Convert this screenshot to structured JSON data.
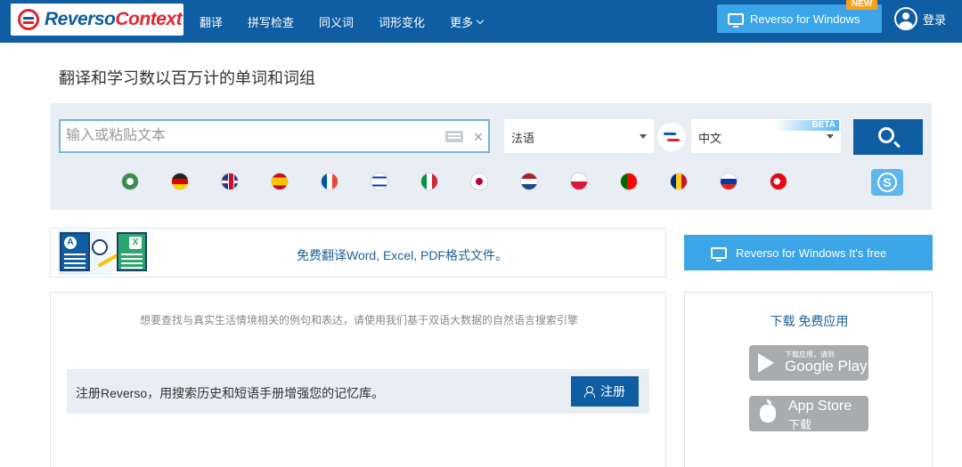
{
  "header": {
    "logo_reverso": "Reverso",
    "logo_context": "Context",
    "nav": [
      {
        "label": "翻译"
      },
      {
        "label": "拼写检查"
      },
      {
        "label": "同义词"
      },
      {
        "label": "词形变化"
      },
      {
        "label": "更多"
      }
    ],
    "windows_button": "Reverso for Windows",
    "new_badge": "NEW",
    "login": "登录"
  },
  "tagline": "翻译和学习数以百万计的单词和词组",
  "search": {
    "placeholder": "输入或粘贴文本",
    "value": "",
    "clear_icon": "×",
    "source_language": "法语",
    "target_language": "中文",
    "beta_badge": "BETA"
  },
  "flags": [
    "arabic",
    "german",
    "english",
    "spanish",
    "french",
    "hebrew",
    "italian",
    "japanese",
    "dutch",
    "polish",
    "portuguese",
    "romanian",
    "russian",
    "turkish"
  ],
  "skype_letter": "S",
  "doc_banner": {
    "text": "免费翻译Word, Excel, PDF格式文件。",
    "icon_a": "A",
    "icon_x": "X"
  },
  "free_button": "Reverso for Windows It's free",
  "context": {
    "description": "想要查找与真实生活情境相关的例句和表达，请使用我们基于双语大数据的自然语言搜索引擎",
    "register_text": "注册Reverso，用搜索历史和短语手册增强您的记忆库。",
    "register_button": "注册"
  },
  "apps": {
    "title": "下载 免费应用",
    "google_small": "下载应用，请到",
    "google_big": "Google Play",
    "apple_big": "App Store",
    "apple_small": "下载"
  },
  "colors": {
    "brand_blue": "#0f5da2",
    "brand_red": "#e0262c",
    "light_blue": "#3ba5e7",
    "panel_bg": "#e8eef3"
  }
}
